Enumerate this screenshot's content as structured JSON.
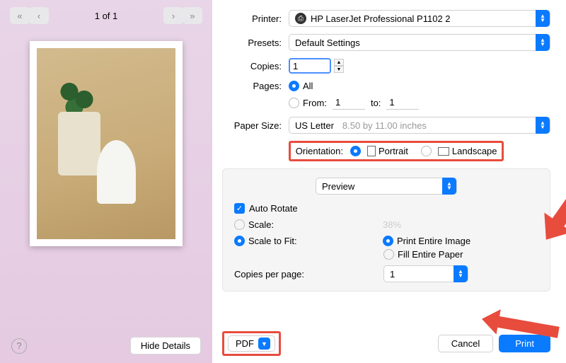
{
  "preview": {
    "page_counter": "1 of 1"
  },
  "printer": {
    "label": "Printer:",
    "value": "HP LaserJet Professional P1102 2"
  },
  "presets": {
    "label": "Presets:",
    "value": "Default Settings"
  },
  "copies": {
    "label": "Copies:",
    "value": "1"
  },
  "pages": {
    "label": "Pages:",
    "all": "All",
    "from_label": "From:",
    "from_value": "1",
    "to_label": "to:",
    "to_value": "1"
  },
  "paper_size": {
    "label": "Paper Size:",
    "value": "US Letter",
    "hint": "8.50 by 11.00 inches"
  },
  "orientation": {
    "label": "Orientation:",
    "portrait": "Portrait",
    "landscape": "Landscape"
  },
  "app_menu": {
    "value": "Preview"
  },
  "options": {
    "auto_rotate": "Auto Rotate",
    "scale": "Scale:",
    "scale_value": "38%",
    "scale_to_fit": "Scale to Fit:",
    "print_entire": "Print Entire Image",
    "fill_entire": "Fill Entire Paper",
    "copies_per_page": "Copies per page:",
    "copies_per_page_value": "1"
  },
  "footer": {
    "pdf": "PDF",
    "hide_details": "Hide Details",
    "cancel": "Cancel",
    "print": "Print"
  },
  "annotation": {
    "highlight_color": "#E84C3D"
  }
}
